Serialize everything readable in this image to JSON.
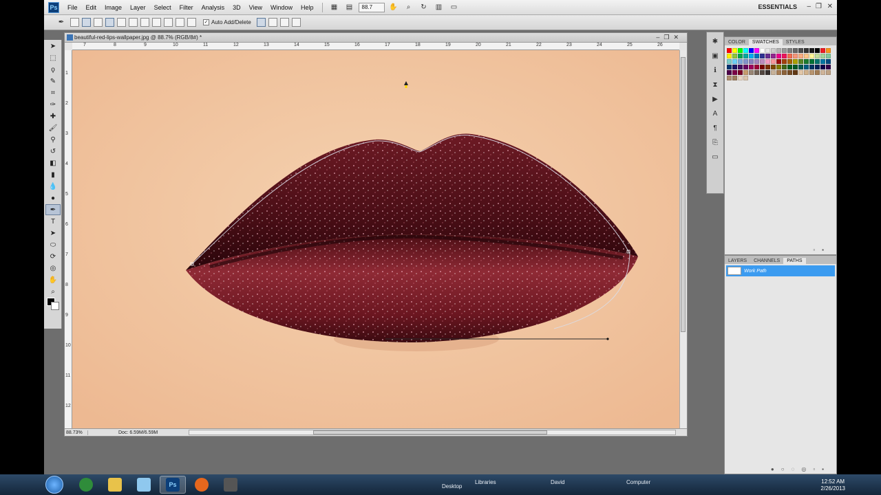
{
  "app": {
    "logo": "Ps",
    "menus": [
      "File",
      "Edit",
      "Image",
      "Layer",
      "Select",
      "Filter",
      "Analysis",
      "3D",
      "View",
      "Window",
      "Help"
    ],
    "zoom_field": "88.7",
    "workspace": "ESSENTIALS"
  },
  "options": {
    "auto_add_delete_label": "Auto Add/Delete",
    "auto_add_delete_checked": "✓"
  },
  "document": {
    "title": "beautiful-red-lips-wallpaper.jpg @ 88.7% (RGB/8#) *",
    "ruler_h": [
      "7",
      "8",
      "9",
      "10",
      "11",
      "12",
      "13",
      "14",
      "15",
      "16",
      "17",
      "18",
      "19",
      "20",
      "21",
      "22",
      "23",
      "24",
      "25",
      "26"
    ],
    "ruler_v": [
      "1",
      "2",
      "3",
      "4",
      "5",
      "6",
      "7",
      "8",
      "9",
      "10",
      "11",
      "12"
    ],
    "status_zoom": "88.73%",
    "status_doc": "Doc: 6.59M/6.59M"
  },
  "panels": {
    "top_tabs": [
      "COLOR",
      "SWATCHES",
      "STYLES"
    ],
    "top_active": "SWATCHES",
    "bottom_tabs": [
      "LAYERS",
      "CHANNELS",
      "PATHS"
    ],
    "bottom_active": "PATHS",
    "path_name": "Work Path"
  },
  "taskbar": {
    "links": [
      "Desktop",
      "Libraries",
      "David",
      "Computer"
    ],
    "time": "12:52 AM",
    "date": "2/26/2013"
  },
  "colors": {
    "swatches": [
      "#ff0000",
      "#ffff00",
      "#00ff00",
      "#00ffff",
      "#0000ff",
      "#ff00ff",
      "#ffffff",
      "#e6e6e6",
      "#cccccc",
      "#b3b3b3",
      "#999999",
      "#808080",
      "#666666",
      "#4d4d4d",
      "#333333",
      "#1a1a1a",
      "#000000",
      "#ed1c24",
      "#f7941d",
      "#fff200",
      "#8dc63f",
      "#00a651",
      "#00a99d",
      "#00aeef",
      "#0072bc",
      "#2e3192",
      "#662d91",
      "#92278f",
      "#ec008c",
      "#ed145b",
      "#f26c4f",
      "#f69679",
      "#f9ad81",
      "#fdc689",
      "#fff799",
      "#c4df9b",
      "#a3d39c",
      "#82ca9c",
      "#7accc8",
      "#6dcff6",
      "#7da7d9",
      "#8393ca",
      "#8781bd",
      "#a186be",
      "#bd8cbf",
      "#f49ac2",
      "#f6989d",
      "#9e0b0f",
      "#a0410d",
      "#a36209",
      "#aba000",
      "#598527",
      "#1a7b30",
      "#007236",
      "#00746b",
      "#0076a3",
      "#004a80",
      "#003471",
      "#1b1464",
      "#440e62",
      "#630460",
      "#9e005d",
      "#9e0039",
      "#790000",
      "#7b2e00",
      "#7d4900",
      "#827b00",
      "#406618",
      "#005e20",
      "#005826",
      "#005952",
      "#005b7f",
      "#003663",
      "#002157",
      "#0d004c",
      "#32004b",
      "#4b0049",
      "#7b0046",
      "#7a0026",
      "#c69c6d",
      "#998675",
      "#736357",
      "#534741",
      "#362f2d",
      "#c7b299",
      "#a67c52",
      "#8c6239",
      "#754c24",
      "#603813",
      "#e2c7a8",
      "#d1b28d",
      "#b89570",
      "#a17c55",
      "#cfb59a",
      "#bfa385",
      "#b08f70",
      "#9e7d5f",
      "#e8d6c3",
      "#dac5ac"
    ]
  }
}
